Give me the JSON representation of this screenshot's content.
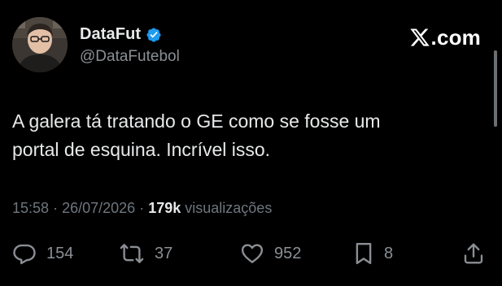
{
  "author": {
    "display_name": "DataFut",
    "handle": "@DataFutebol",
    "verified": true
  },
  "brand": {
    "domain": ".com",
    "logo_icon": "x-logo-icon"
  },
  "tweet": {
    "text_lines": [
      "A galera tá tratando o GE como se fosse um",
      "portal de esquina. Incrível isso."
    ],
    "time": "15:58",
    "date": "26/07/2026",
    "separator": "·",
    "views_count": "179k",
    "views_label": "visualizações"
  },
  "actions": {
    "replies": "154",
    "retweets": "37",
    "likes": "952",
    "bookmarks": "8"
  },
  "colors": {
    "background": "#000000",
    "text_primary": "#e7e9ea",
    "text_secondary": "#6e767d",
    "verified_badge": "#1d9bf0"
  },
  "icons": [
    "verified-badge-icon",
    "x-logo-icon",
    "reply-icon",
    "retweet-icon",
    "like-icon",
    "bookmark-icon",
    "share-icon"
  ]
}
